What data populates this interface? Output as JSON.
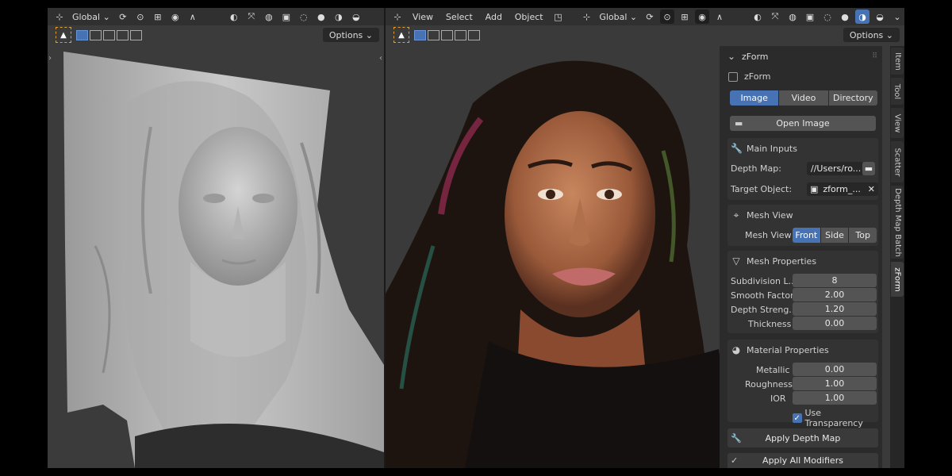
{
  "left_header": {
    "transform_orientation": "Global",
    "options_label": "Options"
  },
  "right_header": {
    "menus": [
      "View",
      "Select",
      "Add",
      "Object"
    ],
    "transform_orientation": "Global",
    "options_label": "Options"
  },
  "npanel": {
    "title": "zForm",
    "enable_label": "zForm",
    "enable_checked": false,
    "source_tabs": [
      {
        "label": "Image",
        "active": true
      },
      {
        "label": "Video",
        "active": false
      },
      {
        "label": "Directory",
        "active": false
      }
    ],
    "open_image_label": "Open Image",
    "main_inputs": {
      "title": "Main Inputs",
      "depth_map_label": "Depth Map:",
      "depth_map_value": "//Users/ro...",
      "target_object_label": "Target Object:",
      "target_object_value": "zform_..."
    },
    "mesh_view": {
      "title": "Mesh View",
      "label": "Mesh View",
      "options": [
        {
          "label": "Front",
          "active": true
        },
        {
          "label": "Side",
          "active": false
        },
        {
          "label": "Top",
          "active": false
        }
      ]
    },
    "mesh_properties": {
      "title": "Mesh Properties",
      "fields": [
        {
          "label": "Subdivision L...",
          "value": "8"
        },
        {
          "label": "Smooth Factor",
          "value": "2.00"
        },
        {
          "label": "Depth Streng...",
          "value": "1.20"
        },
        {
          "label": "Thickness",
          "value": "0.00"
        }
      ]
    },
    "material_properties": {
      "title": "Material Properties",
      "fields": [
        {
          "label": "Metallic",
          "value": "0.00"
        },
        {
          "label": "Roughness",
          "value": "1.00"
        },
        {
          "label": "IOR",
          "value": "1.00"
        }
      ],
      "use_transparency_label": "Use Transparency",
      "use_transparency_checked": true
    },
    "apply_depth_map_label": "Apply Depth Map",
    "apply_all_modifiers_label": "Apply All Modifiers"
  },
  "side_tabs": [
    {
      "label": "Item",
      "active": false
    },
    {
      "label": "Tool",
      "active": false
    },
    {
      "label": "View",
      "active": false
    },
    {
      "label": "Scatter",
      "active": false
    },
    {
      "label": "Depth Map Batch",
      "active": false
    },
    {
      "label": "zForm",
      "active": true
    }
  ],
  "colors": {
    "accent": "#4772b3",
    "viewport_bg": "#3b3b3b",
    "panel_bg": "#2b2b2b"
  }
}
